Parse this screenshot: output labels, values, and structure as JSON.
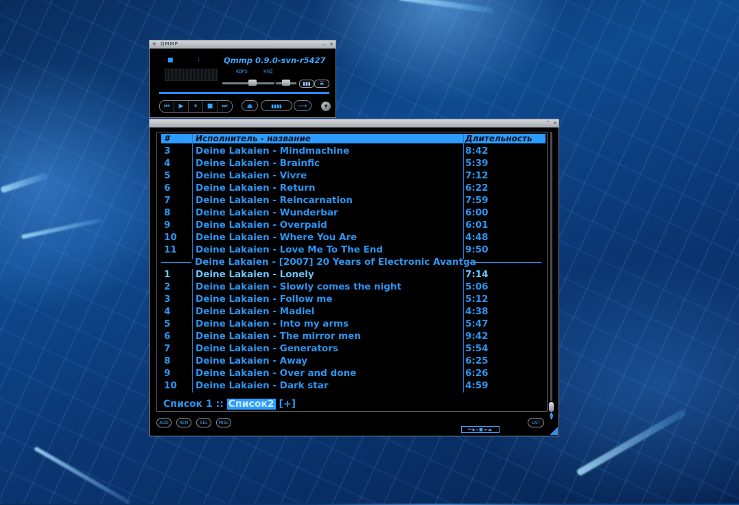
{
  "player": {
    "title": "QMMP",
    "version": "Qmmp 0.9.0-svn-r5427",
    "kbps_label": "KBPS",
    "khz_label": "KHZ",
    "time_separator": ":",
    "volume_level": 0.6,
    "balance_level": 0.5,
    "controls": {
      "prev": "⏮",
      "play": "▶",
      "pause": "⏸",
      "stop": "■",
      "next": "⏭"
    },
    "eject_icon": "⏏",
    "eq_icon": "▮▮▮▮",
    "repeat_icon": "⟶",
    "menu_icon": "≡",
    "min_icon": "–",
    "close_icon": "×"
  },
  "playlist": {
    "columns": {
      "number": "#",
      "artist_title": "Исполнитель - название",
      "duration": "Длительность"
    },
    "rows_group1": [
      {
        "num": "3",
        "title": "Deine Lakaien - Mindmachine",
        "dur": "8:42"
      },
      {
        "num": "4",
        "title": "Deine Lakaien - Brainfic",
        "dur": "5:39"
      },
      {
        "num": "5",
        "title": "Deine Lakaien - Vivre",
        "dur": "7:12"
      },
      {
        "num": "6",
        "title": "Deine Lakaien - Return",
        "dur": "6:22"
      },
      {
        "num": "7",
        "title": "Deine Lakaien - Reincarnation",
        "dur": "7:59"
      },
      {
        "num": "8",
        "title": "Deine Lakaien - Wunderbar",
        "dur": "6:00"
      },
      {
        "num": "9",
        "title": "Deine Lakaien - Overpaid",
        "dur": "6:01"
      },
      {
        "num": "10",
        "title": "Deine Lakaien - Where You Are",
        "dur": "4:48"
      },
      {
        "num": "11",
        "title": "Deine Lakaien - Love Me To The End",
        "dur": "9:50"
      }
    ],
    "group_header": "Deine Lakaien - [2007] 20 Years of Electronic Avantga",
    "rows_group2": [
      {
        "num": "1",
        "title": "Deine Lakaien - Lonely",
        "dur": "7:14"
      },
      {
        "num": "2",
        "title": "Deine Lakaien - Slowly comes the night",
        "dur": "5:06"
      },
      {
        "num": "3",
        "title": "Deine Lakaien - Follow me",
        "dur": "5:12"
      },
      {
        "num": "4",
        "title": "Deine Lakaien - Madiel",
        "dur": "4:38"
      },
      {
        "num": "5",
        "title": "Deine Lakaien - Into my arms",
        "dur": "5:47"
      },
      {
        "num": "6",
        "title": "Deine Lakaien - The mirror men",
        "dur": "9:42"
      },
      {
        "num": "7",
        "title": "Deine Lakaien - Generators",
        "dur": "5:54"
      },
      {
        "num": "8",
        "title": "Deine Lakaien - Away",
        "dur": "6:25"
      },
      {
        "num": "9",
        "title": "Deine Lakaien - Over and done",
        "dur": "6:26"
      },
      {
        "num": "10",
        "title": "Deine Lakaien - Dark star",
        "dur": "4:59"
      }
    ],
    "tabs": {
      "tab1": "Список 1",
      "separator": "::",
      "tab2": "Список2",
      "add": "[+]"
    },
    "buttons": {
      "add": "ADD",
      "rem": "REM",
      "sel": "SEL",
      "misc": "MISC",
      "list": "LIST"
    },
    "mini_controls": "⏮▶⏸■⏭⏏"
  },
  "colors": {
    "accent": "#2d9cff",
    "text": "#2b95f0",
    "current": "#69c7ff"
  }
}
